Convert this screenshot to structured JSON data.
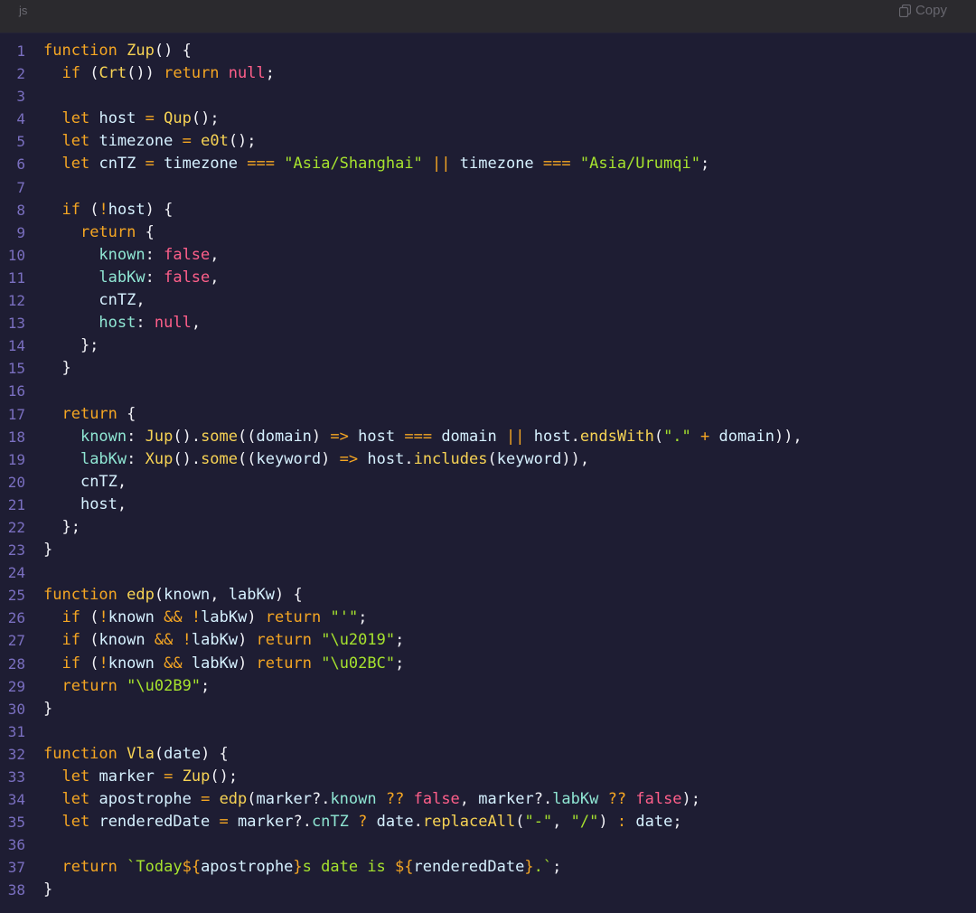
{
  "header": {
    "language": "js",
    "copy_label": "Copy"
  },
  "colors": {
    "background": "#1e1d33",
    "header_bg": "#2b2a2e",
    "line_number": "#7a6fc0",
    "keyword": "#f5a623",
    "function_name": "#f7d354",
    "string": "#a6e22e",
    "literal": "#ff5f8a",
    "property": "#8fe6d3",
    "identifier": "#d6f1ff"
  },
  "code": {
    "lines": [
      [
        [
          "kw",
          "function"
        ],
        [
          "p",
          " "
        ],
        [
          "fn",
          "Zup"
        ],
        [
          "p",
          "() {"
        ]
      ],
      [
        [
          "p",
          "  "
        ],
        [
          "kw",
          "if"
        ],
        [
          "p",
          " ("
        ],
        [
          "fn",
          "Crt"
        ],
        [
          "p",
          "()) "
        ],
        [
          "kw",
          "return"
        ],
        [
          "p",
          " "
        ],
        [
          "bool",
          "null"
        ],
        [
          "p",
          ";"
        ]
      ],
      [],
      [
        [
          "p",
          "  "
        ],
        [
          "kw",
          "let"
        ],
        [
          "p",
          " "
        ],
        [
          "id",
          "host"
        ],
        [
          "p",
          " "
        ],
        [
          "op",
          "="
        ],
        [
          "p",
          " "
        ],
        [
          "fn",
          "Qup"
        ],
        [
          "p",
          "();"
        ]
      ],
      [
        [
          "p",
          "  "
        ],
        [
          "kw",
          "let"
        ],
        [
          "p",
          " "
        ],
        [
          "id",
          "timezone"
        ],
        [
          "p",
          " "
        ],
        [
          "op",
          "="
        ],
        [
          "p",
          " "
        ],
        [
          "fn",
          "e0t"
        ],
        [
          "p",
          "();"
        ]
      ],
      [
        [
          "p",
          "  "
        ],
        [
          "kw",
          "let"
        ],
        [
          "p",
          " "
        ],
        [
          "id",
          "cnTZ"
        ],
        [
          "p",
          " "
        ],
        [
          "op",
          "="
        ],
        [
          "p",
          " "
        ],
        [
          "id",
          "timezone"
        ],
        [
          "p",
          " "
        ],
        [
          "op",
          "==="
        ],
        [
          "p",
          " "
        ],
        [
          "str",
          "\"Asia/Shanghai\""
        ],
        [
          "p",
          " "
        ],
        [
          "op",
          "||"
        ],
        [
          "p",
          " "
        ],
        [
          "id",
          "timezone"
        ],
        [
          "p",
          " "
        ],
        [
          "op",
          "==="
        ],
        [
          "p",
          " "
        ],
        [
          "str",
          "\"Asia/Urumqi\""
        ],
        [
          "p",
          ";"
        ]
      ],
      [],
      [
        [
          "p",
          "  "
        ],
        [
          "kw",
          "if"
        ],
        [
          "p",
          " ("
        ],
        [
          "op",
          "!"
        ],
        [
          "id",
          "host"
        ],
        [
          "p",
          ") {"
        ]
      ],
      [
        [
          "p",
          "    "
        ],
        [
          "kw",
          "return"
        ],
        [
          "p",
          " {"
        ]
      ],
      [
        [
          "p",
          "      "
        ],
        [
          "prop",
          "known"
        ],
        [
          "p",
          ": "
        ],
        [
          "bool",
          "false"
        ],
        [
          "p",
          ","
        ]
      ],
      [
        [
          "p",
          "      "
        ],
        [
          "prop",
          "labKw"
        ],
        [
          "p",
          ": "
        ],
        [
          "bool",
          "false"
        ],
        [
          "p",
          ","
        ]
      ],
      [
        [
          "p",
          "      "
        ],
        [
          "id",
          "cnTZ"
        ],
        [
          "p",
          ","
        ]
      ],
      [
        [
          "p",
          "      "
        ],
        [
          "prop",
          "host"
        ],
        [
          "p",
          ": "
        ],
        [
          "bool",
          "null"
        ],
        [
          "p",
          ","
        ]
      ],
      [
        [
          "p",
          "    };"
        ]
      ],
      [
        [
          "p",
          "  }"
        ]
      ],
      [],
      [
        [
          "p",
          "  "
        ],
        [
          "kw",
          "return"
        ],
        [
          "p",
          " {"
        ]
      ],
      [
        [
          "p",
          "    "
        ],
        [
          "prop",
          "known"
        ],
        [
          "p",
          ": "
        ],
        [
          "fn",
          "Jup"
        ],
        [
          "p",
          "()."
        ],
        [
          "fn",
          "some"
        ],
        [
          "p",
          "(("
        ],
        [
          "id",
          "domain"
        ],
        [
          "p",
          ") "
        ],
        [
          "op",
          "=>"
        ],
        [
          "p",
          " "
        ],
        [
          "id",
          "host"
        ],
        [
          "p",
          " "
        ],
        [
          "op",
          "==="
        ],
        [
          "p",
          " "
        ],
        [
          "id",
          "domain"
        ],
        [
          "p",
          " "
        ],
        [
          "op",
          "||"
        ],
        [
          "p",
          " "
        ],
        [
          "id",
          "host"
        ],
        [
          "p",
          "."
        ],
        [
          "fn",
          "endsWith"
        ],
        [
          "p",
          "("
        ],
        [
          "str",
          "\".\""
        ],
        [
          "p",
          " "
        ],
        [
          "op",
          "+"
        ],
        [
          "p",
          " "
        ],
        [
          "id",
          "domain"
        ],
        [
          "p",
          ")),"
        ]
      ],
      [
        [
          "p",
          "    "
        ],
        [
          "prop",
          "labKw"
        ],
        [
          "p",
          ": "
        ],
        [
          "fn",
          "Xup"
        ],
        [
          "p",
          "()."
        ],
        [
          "fn",
          "some"
        ],
        [
          "p",
          "(("
        ],
        [
          "id",
          "keyword"
        ],
        [
          "p",
          ") "
        ],
        [
          "op",
          "=>"
        ],
        [
          "p",
          " "
        ],
        [
          "id",
          "host"
        ],
        [
          "p",
          "."
        ],
        [
          "fn",
          "includes"
        ],
        [
          "p",
          "("
        ],
        [
          "id",
          "keyword"
        ],
        [
          "p",
          ")),"
        ]
      ],
      [
        [
          "p",
          "    "
        ],
        [
          "id",
          "cnTZ"
        ],
        [
          "p",
          ","
        ]
      ],
      [
        [
          "p",
          "    "
        ],
        [
          "id",
          "host"
        ],
        [
          "p",
          ","
        ]
      ],
      [
        [
          "p",
          "  };"
        ]
      ],
      [
        [
          "p",
          "}"
        ]
      ],
      [],
      [
        [
          "kw",
          "function"
        ],
        [
          "p",
          " "
        ],
        [
          "fn",
          "edp"
        ],
        [
          "p",
          "("
        ],
        [
          "id",
          "known"
        ],
        [
          "p",
          ", "
        ],
        [
          "id",
          "labKw"
        ],
        [
          "p",
          ") {"
        ]
      ],
      [
        [
          "p",
          "  "
        ],
        [
          "kw",
          "if"
        ],
        [
          "p",
          " ("
        ],
        [
          "op",
          "!"
        ],
        [
          "id",
          "known"
        ],
        [
          "p",
          " "
        ],
        [
          "op",
          "&&"
        ],
        [
          "p",
          " "
        ],
        [
          "op",
          "!"
        ],
        [
          "id",
          "labKw"
        ],
        [
          "p",
          ") "
        ],
        [
          "kw",
          "return"
        ],
        [
          "p",
          " "
        ],
        [
          "str",
          "\"'\""
        ],
        [
          "p",
          ";"
        ]
      ],
      [
        [
          "p",
          "  "
        ],
        [
          "kw",
          "if"
        ],
        [
          "p",
          " ("
        ],
        [
          "id",
          "known"
        ],
        [
          "p",
          " "
        ],
        [
          "op",
          "&&"
        ],
        [
          "p",
          " "
        ],
        [
          "op",
          "!"
        ],
        [
          "id",
          "labKw"
        ],
        [
          "p",
          ") "
        ],
        [
          "kw",
          "return"
        ],
        [
          "p",
          " "
        ],
        [
          "str",
          "\"\\u2019\""
        ],
        [
          "p",
          ";"
        ]
      ],
      [
        [
          "p",
          "  "
        ],
        [
          "kw",
          "if"
        ],
        [
          "p",
          " ("
        ],
        [
          "op",
          "!"
        ],
        [
          "id",
          "known"
        ],
        [
          "p",
          " "
        ],
        [
          "op",
          "&&"
        ],
        [
          "p",
          " "
        ],
        [
          "id",
          "labKw"
        ],
        [
          "p",
          ") "
        ],
        [
          "kw",
          "return"
        ],
        [
          "p",
          " "
        ],
        [
          "str",
          "\"\\u02BC\""
        ],
        [
          "p",
          ";"
        ]
      ],
      [
        [
          "p",
          "  "
        ],
        [
          "kw",
          "return"
        ],
        [
          "p",
          " "
        ],
        [
          "str",
          "\"\\u02B9\""
        ],
        [
          "p",
          ";"
        ]
      ],
      [
        [
          "p",
          "}"
        ]
      ],
      [],
      [
        [
          "kw",
          "function"
        ],
        [
          "p",
          " "
        ],
        [
          "fn",
          "Vla"
        ],
        [
          "p",
          "("
        ],
        [
          "id",
          "date"
        ],
        [
          "p",
          ") {"
        ]
      ],
      [
        [
          "p",
          "  "
        ],
        [
          "kw",
          "let"
        ],
        [
          "p",
          " "
        ],
        [
          "id",
          "marker"
        ],
        [
          "p",
          " "
        ],
        [
          "op",
          "="
        ],
        [
          "p",
          " "
        ],
        [
          "fn",
          "Zup"
        ],
        [
          "p",
          "();"
        ]
      ],
      [
        [
          "p",
          "  "
        ],
        [
          "kw",
          "let"
        ],
        [
          "p",
          " "
        ],
        [
          "id",
          "apostrophe"
        ],
        [
          "p",
          " "
        ],
        [
          "op",
          "="
        ],
        [
          "p",
          " "
        ],
        [
          "fn",
          "edp"
        ],
        [
          "p",
          "("
        ],
        [
          "id",
          "marker"
        ],
        [
          "p",
          "?."
        ],
        [
          "prop",
          "known"
        ],
        [
          "p",
          " "
        ],
        [
          "op",
          "??"
        ],
        [
          "p",
          " "
        ],
        [
          "bool",
          "false"
        ],
        [
          "p",
          ", "
        ],
        [
          "id",
          "marker"
        ],
        [
          "p",
          "?."
        ],
        [
          "prop",
          "labKw"
        ],
        [
          "p",
          " "
        ],
        [
          "op",
          "??"
        ],
        [
          "p",
          " "
        ],
        [
          "bool",
          "false"
        ],
        [
          "p",
          ");"
        ]
      ],
      [
        [
          "p",
          "  "
        ],
        [
          "kw",
          "let"
        ],
        [
          "p",
          " "
        ],
        [
          "id",
          "renderedDate"
        ],
        [
          "p",
          " "
        ],
        [
          "op",
          "="
        ],
        [
          "p",
          " "
        ],
        [
          "id",
          "marker"
        ],
        [
          "p",
          "?."
        ],
        [
          "prop",
          "cnTZ"
        ],
        [
          "p",
          " "
        ],
        [
          "op",
          "?"
        ],
        [
          "p",
          " "
        ],
        [
          "id",
          "date"
        ],
        [
          "p",
          "."
        ],
        [
          "fn",
          "replaceAll"
        ],
        [
          "p",
          "("
        ],
        [
          "str",
          "\"-\""
        ],
        [
          "p",
          ", "
        ],
        [
          "str",
          "\"/\""
        ],
        [
          "p",
          ") "
        ],
        [
          "op",
          ":"
        ],
        [
          "p",
          " "
        ],
        [
          "id",
          "date"
        ],
        [
          "p",
          ";"
        ]
      ],
      [],
      [
        [
          "p",
          "  "
        ],
        [
          "kw",
          "return"
        ],
        [
          "p",
          " "
        ],
        [
          "str",
          "`Today"
        ],
        [
          "kw",
          "${"
        ],
        [
          "id",
          "apostrophe"
        ],
        [
          "kw",
          "}"
        ],
        [
          "str",
          "s date is "
        ],
        [
          "kw",
          "${"
        ],
        [
          "id",
          "renderedDate"
        ],
        [
          "kw",
          "}"
        ],
        [
          "str",
          ".`"
        ],
        [
          "p",
          ";"
        ]
      ],
      [
        [
          "p",
          "}"
        ]
      ]
    ]
  }
}
